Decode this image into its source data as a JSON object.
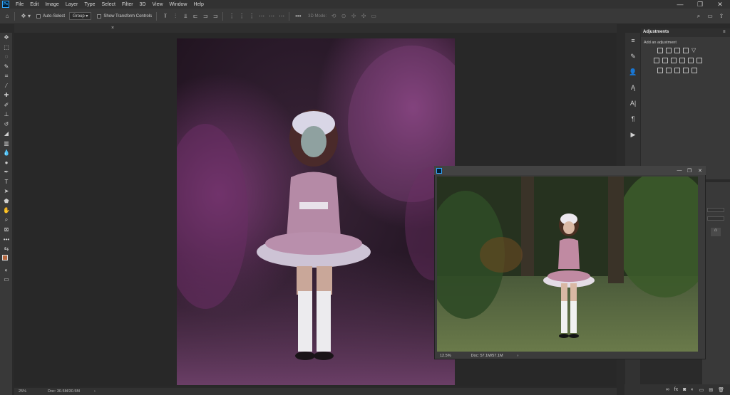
{
  "app": {
    "logo": "Ps"
  },
  "menu": [
    "File",
    "Edit",
    "Image",
    "Layer",
    "Type",
    "Select",
    "Filter",
    "3D",
    "View",
    "Window",
    "Help"
  ],
  "window_controls": {
    "minimize": "—",
    "maximize": "❐",
    "close": "✕"
  },
  "options": {
    "auto_select_label": "Auto-Select",
    "group_value": "Group",
    "show_transform_label": "Show Transform Controls",
    "mode_3d_label": "3D Mode:"
  },
  "tab": {
    "close": "×"
  },
  "status": {
    "zoom": "25%",
    "doc": "Doc: 30.5M/30.5M",
    "arrow": "›"
  },
  "float_window": {
    "zoom": "12.5%",
    "doc": "Doc: 57.1M/57.1M",
    "arrow": "›"
  },
  "adjustments": {
    "tab_label": "Adjustments",
    "subtitle": "Add an adjustment"
  },
  "dock_icons": [
    "≡",
    "✎",
    "👤",
    "Ą",
    "A|",
    "¶",
    "▶"
  ],
  "colors": {
    "foreground": "#b5673f",
    "background": "#e7a9b5",
    "accent": "#31a8ff"
  }
}
